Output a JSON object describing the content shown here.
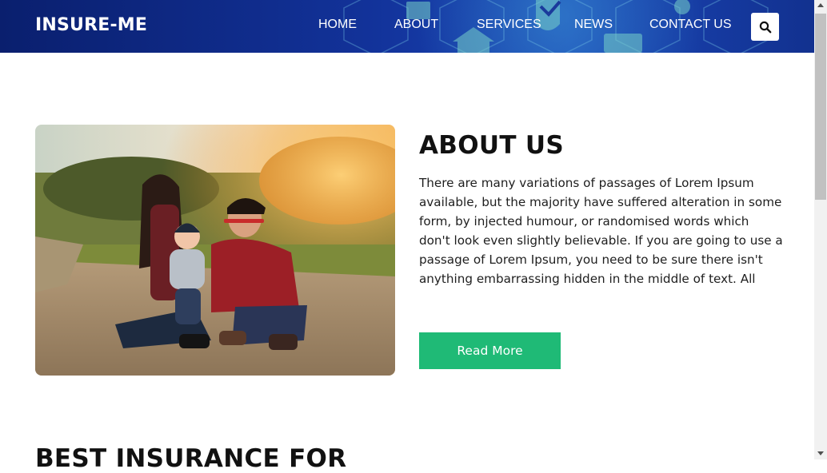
{
  "header": {
    "logo": "INSURE-ME",
    "nav": [
      {
        "label": "HOME"
      },
      {
        "label": "ABOUT"
      },
      {
        "label": "SERVICES"
      },
      {
        "label": "NEWS"
      },
      {
        "label": "CONTACT US"
      }
    ],
    "search_icon": "search-icon"
  },
  "about": {
    "title": "ABOUT US",
    "text": "There are many variations of passages of Lorem Ipsum available, but the majority have suffered alteration in some form, by injected humour, or randomised words which don't look even slightly believable. If you are going to use a passage of Lorem Ipsum, you need to be sure there isn't anything embarrassing hidden in the middle of text. All",
    "button": "Read More"
  },
  "next_section": {
    "title": "BEST INSURANCE FOR"
  },
  "colors": {
    "header_bg": "#123299",
    "accent": "#1fba76",
    "text": "#1e1e1e"
  }
}
